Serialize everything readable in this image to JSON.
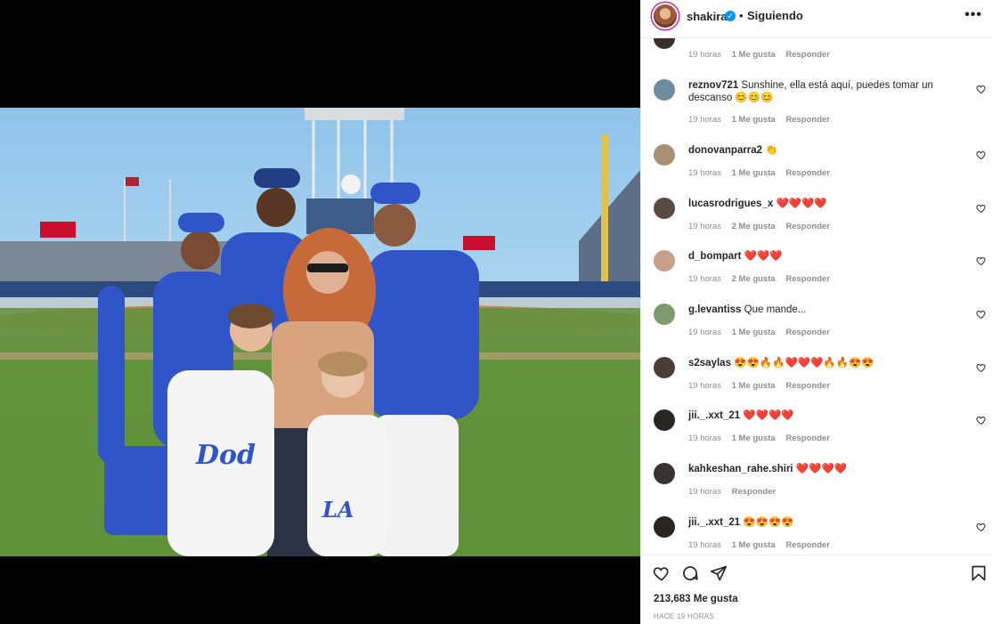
{
  "header": {
    "username": "shakira",
    "verified": true,
    "separator": "•",
    "follow_status": "Siguiendo",
    "more_label": "•••"
  },
  "partial_comment": {
    "time": "19 horas",
    "likes": "1 Me gusta",
    "reply": "Responder"
  },
  "comments": [
    {
      "user": "reznov721",
      "text": "Sunshine, ella está aquí, puedes tomar un descanso 😊😊😊",
      "time": "19 horas",
      "likes": "1 Me gusta",
      "reply": "Responder",
      "avatar_color": "#6d8c9e"
    },
    {
      "user": "donovanparra2",
      "text": "👏",
      "time": "19 horas",
      "likes": "1 Me gusta",
      "reply": "Responder",
      "avatar_color": "#a98f74"
    },
    {
      "user": "lucasrodrigues_x",
      "text": "❤️❤️❤️❤️",
      "time": "19 horas",
      "likes": "2 Me gusta",
      "reply": "Responder",
      "avatar_color": "#5a4a42"
    },
    {
      "user": "d_bompart",
      "text": "❤️❤️❤️",
      "time": "19 horas",
      "likes": "2 Me gusta",
      "reply": "Responder",
      "avatar_color": "#c8a08a"
    },
    {
      "user": "g.levantiss",
      "text": "Que mande...",
      "time": "19 horas",
      "likes": "1 Me gusta",
      "reply": "Responder",
      "avatar_color": "#7f9a6e"
    },
    {
      "user": "s2saylas",
      "text": "😍😍🔥🔥❤️❤️❤️🔥🔥😍😍",
      "time": "19 horas",
      "likes": "1 Me gusta",
      "reply": "Responder",
      "avatar_color": "#4c3d38"
    },
    {
      "user": "jii._.xxt_21",
      "text": "❤️❤️❤️❤️",
      "time": "19 horas",
      "likes": "1 Me gusta",
      "reply": "Responder",
      "avatar_color": "#2b2424"
    },
    {
      "user": "kahkeshan_rahe.shiri",
      "text": "❤️❤️❤️❤️",
      "time": "19 horas",
      "likes": "",
      "reply": "Responder",
      "avatar_color": "#3b3333"
    },
    {
      "user": "jii._.xxt_21",
      "text": "😍😍😍😍",
      "time": "19 horas",
      "likes": "1 Me gusta",
      "reply": "Responder",
      "avatar_color": "#2b2424"
    }
  ],
  "icons": {
    "like": "heart-icon",
    "comment": "comment-icon",
    "share": "share-icon",
    "save": "bookmark-icon"
  },
  "footer": {
    "likes_count": "213,683 Me gusta",
    "posted_ago": "HACE 19 HORAS"
  },
  "colors": {
    "verified": "#0095f6",
    "meta_gray": "#8e8e8e",
    "text": "#262626",
    "dodgers_blue": "#2f55c9"
  }
}
